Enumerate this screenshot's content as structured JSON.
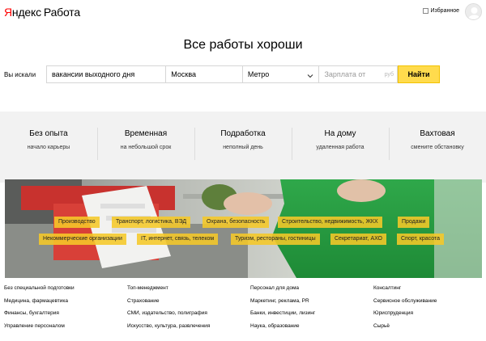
{
  "header": {
    "logo_brand_first": "Я",
    "logo_brand_rest": "ндекс",
    "logo_product": "Работа",
    "favorites_label": "Избранное",
    "brand_color": "#ff0000"
  },
  "hero": {
    "title": "Все работы хороши"
  },
  "search": {
    "label": "Вы искали",
    "query_value": "вакансии выходного дня",
    "city_value": "Москва",
    "metro_value": "Метро",
    "salary_placeholder": "Зарплата от",
    "salary_currency": "руб",
    "button_label": "Найти",
    "button_color": "#ffdb4d"
  },
  "categories": [
    {
      "title": "Без опыта",
      "subtitle": "начало карьеры"
    },
    {
      "title": "Временная",
      "subtitle": "на небольшой срок"
    },
    {
      "title": "Подработка",
      "subtitle": "неполный день"
    },
    {
      "title": "На дому",
      "subtitle": "удаленная работа"
    },
    {
      "title": "Вахтовая",
      "subtitle": "смените обстановку"
    }
  ],
  "banner_tags": [
    "Производство",
    "Транспорт, логистика, ВЭД",
    "Охрана, безопасность",
    "Строительство, недвижимость, ЖКХ",
    "Продажи",
    "Некоммерческие организации",
    "IT, интернет, связь, телеком",
    "Туризм, рестораны, гостиницы",
    "Секретариат, АХО",
    "Спорт, красота"
  ],
  "footer_links": [
    [
      "Без специальной подготовки",
      "Медицина, фармацевтика",
      "Финансы, бухгалтерия",
      "Управление персоналом"
    ],
    [
      "Топ-менеджмент",
      "Страхование",
      "СМИ, издательство, полиграфия",
      "Искусство, культура, развлечения"
    ],
    [
      "Персонал для дома",
      "Маркетинг, реклама, PR",
      "Банки, инвестиции, лизинг",
      "Наука, образование"
    ],
    [
      "Консалтинг",
      "Сервисное обслуживание",
      "Юриспруденция",
      "Сырьё"
    ]
  ]
}
